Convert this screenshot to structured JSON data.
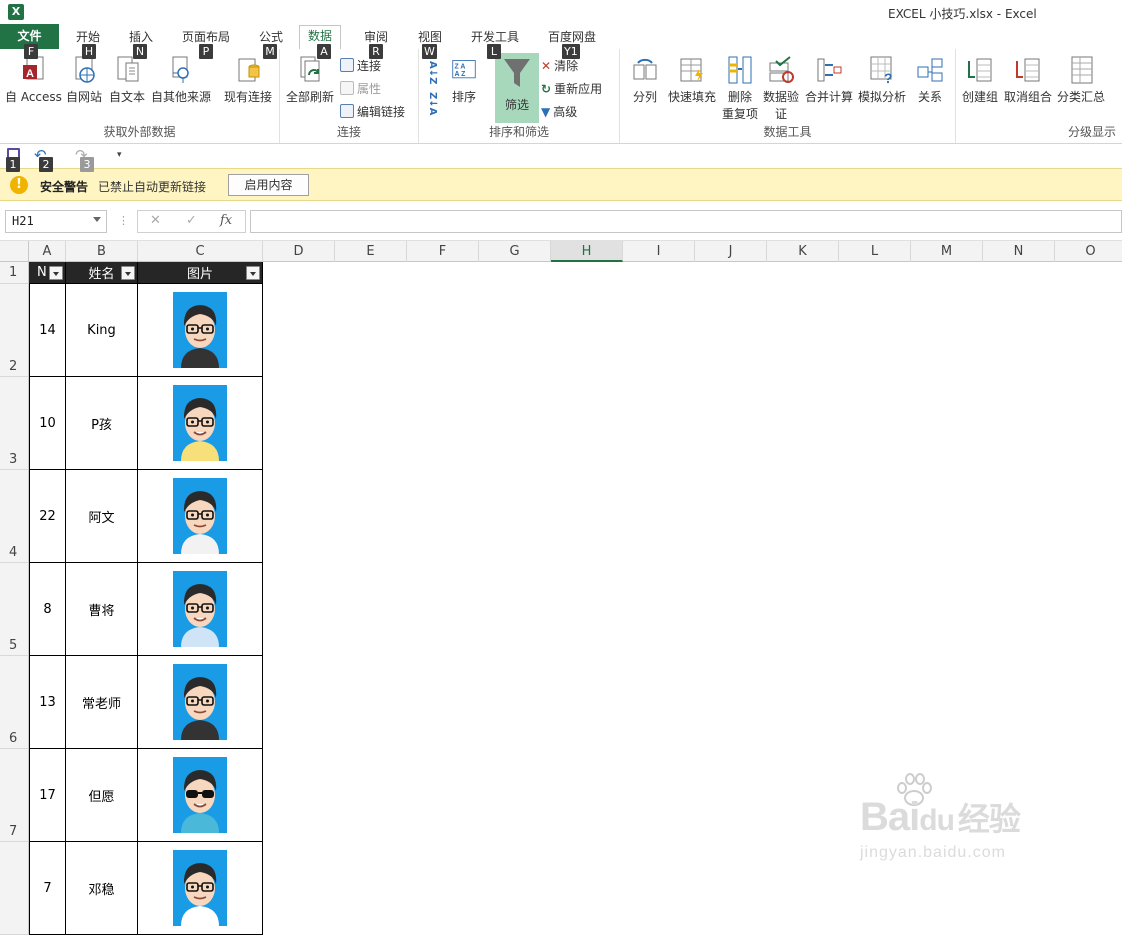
{
  "window": {
    "title": "EXCEL 小技巧.xlsx - Excel",
    "app_badge": "X"
  },
  "tabs": [
    {
      "label": "文件",
      "key": "F"
    },
    {
      "label": "开始",
      "key": "H"
    },
    {
      "label": "插入",
      "key": "N"
    },
    {
      "label": "页面布局",
      "key": "P"
    },
    {
      "label": "公式",
      "key": "M"
    },
    {
      "label": "数据",
      "key": "A"
    },
    {
      "label": "审阅",
      "key": "R"
    },
    {
      "label": "视图",
      "key": "W"
    },
    {
      "label": "开发工具",
      "key": "L"
    },
    {
      "label": "百度网盘",
      "key": "Y1"
    }
  ],
  "ribbon": {
    "get_external": {
      "label": "获取外部数据",
      "from_access": "自 Access",
      "from_web": "自网站",
      "from_text": "自文本",
      "from_other": "自其他来源",
      "existing": "现有连接"
    },
    "connections": {
      "label": "连接",
      "refresh_all": "全部刷新",
      "connections": "连接",
      "properties": "属性",
      "edit_links": "编辑链接"
    },
    "sort_filter": {
      "label": "排序和筛选",
      "sort": "排序",
      "filter": "筛选",
      "clear": "清除",
      "reapply": "重新应用",
      "advanced": "高级",
      "sort_az": "A↓Z",
      "sort_za": "Z↓A"
    },
    "data_tools": {
      "label": "数据工具",
      "text_to_columns": "分列",
      "flash_fill": "快速填充",
      "remove_dup_1": "删除",
      "remove_dup_2": "重复项",
      "validation_1": "数据验",
      "validation_2": "证",
      "consolidate": "合并计算",
      "what_if": "模拟分析",
      "relationships": "关系"
    },
    "outline": {
      "label": "分级显示",
      "group": "创建组",
      "ungroup": "取消组合",
      "subtotal": "分类汇总"
    }
  },
  "qat": {
    "keys": [
      "1",
      "2",
      "3"
    ]
  },
  "security_bar": {
    "title": "安全警告",
    "message": "已禁止自动更新链接",
    "button": "启用内容"
  },
  "formula_bar": {
    "name_box": "H21",
    "fx": "fx",
    "formula": ""
  },
  "columns": [
    "A",
    "B",
    "C",
    "D",
    "E",
    "F",
    "G",
    "H",
    "I",
    "J",
    "K",
    "L",
    "M",
    "N",
    "O"
  ],
  "selected_column": "H",
  "table": {
    "headers": [
      "N",
      "姓名",
      "图片"
    ],
    "rows": [
      {
        "row_num": "2",
        "n": "14",
        "name": "King"
      },
      {
        "row_num": "3",
        "n": "10",
        "name": "P孩"
      },
      {
        "row_num": "4",
        "n": "22",
        "name": "阿文"
      },
      {
        "row_num": "5",
        "n": "8",
        "name": "曹将"
      },
      {
        "row_num": "6",
        "n": "13",
        "name": "常老师"
      },
      {
        "row_num": "7",
        "n": "17",
        "name": "但愿"
      },
      {
        "row_num": "",
        "n": "7",
        "name": "邓稳"
      }
    ],
    "header_row_num": "1"
  },
  "watermark": {
    "brand": "Bai",
    "brand2": "du",
    "cn": "经验",
    "url": "jingyan.baidu.com"
  },
  "colors": {
    "excel_green": "#217346",
    "avatar_bg": "#1a9be6",
    "warn_bg": "#fff5c2"
  }
}
